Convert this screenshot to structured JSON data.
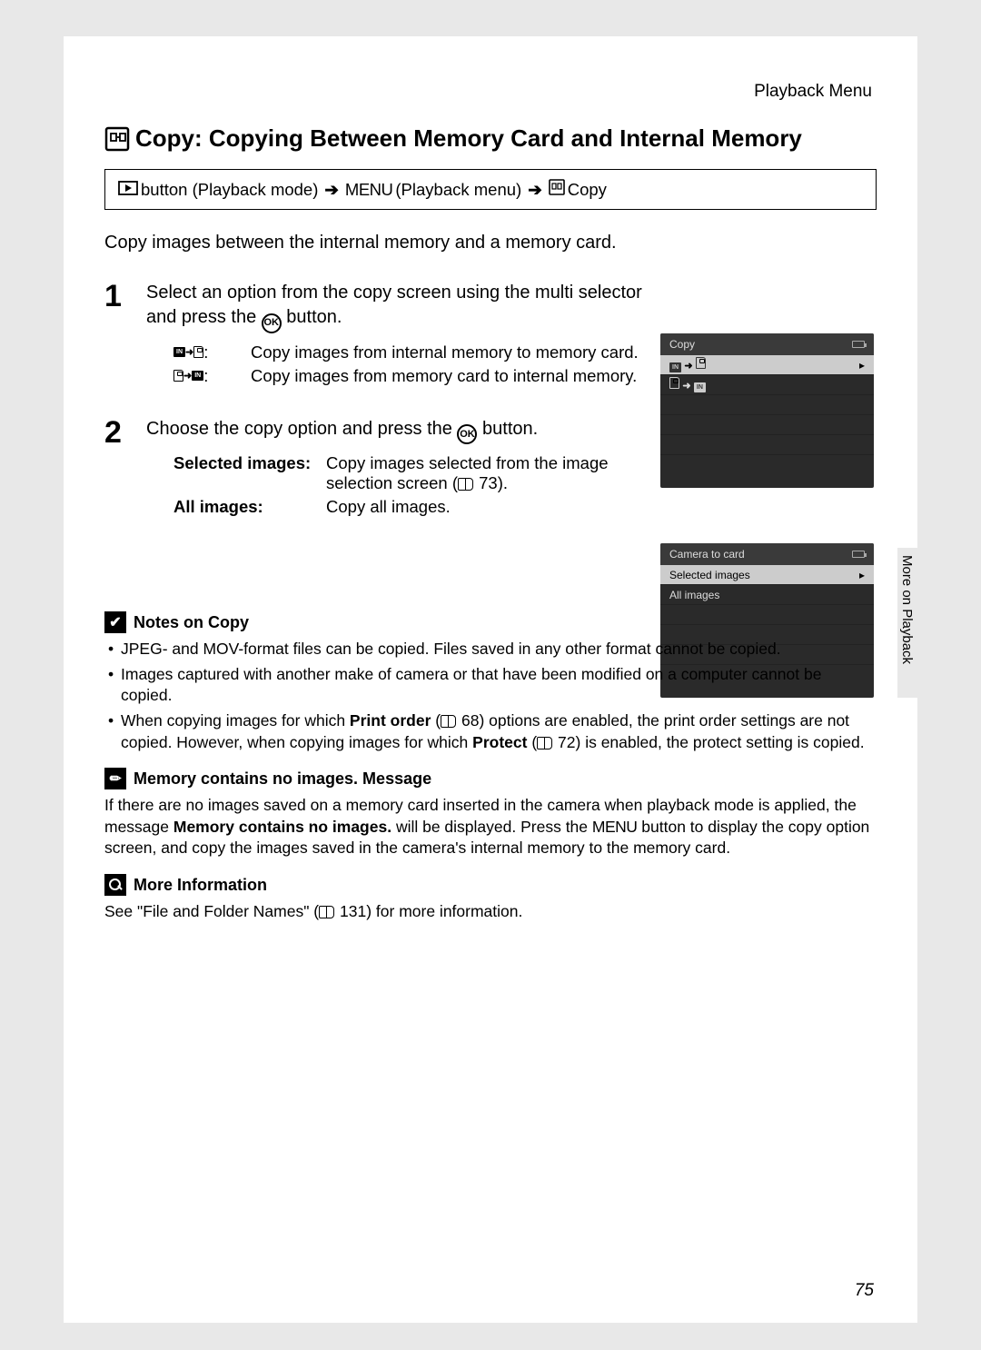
{
  "header": "Playback Menu",
  "sidetab": "More on Playback",
  "title": "Copy: Copying Between Memory Card and Internal Memory",
  "breadcrumb": {
    "b1": "button (Playback mode)",
    "menu": "MENU",
    "b2": "(Playback menu)",
    "b3": "Copy"
  },
  "intro": "Copy images between the internal memory and a memory card.",
  "steps": {
    "s1": {
      "num": "1",
      "heading_a": "Select an option from the copy screen using the multi selector and press the ",
      "heading_b": " button.",
      "opt1": "Copy images from internal memory to memory card.",
      "opt2": "Copy images from memory card to internal memory."
    },
    "s2": {
      "num": "2",
      "heading_a": "Choose the copy option and press the ",
      "heading_b": " button.",
      "sel_lbl": "Selected images",
      "sel_desc_a": "Copy images selected from the image selection screen (",
      "sel_desc_pg": "73",
      "sel_desc_b": ").",
      "all_lbl": "All images",
      "all_desc": "Copy all images."
    }
  },
  "screen1": {
    "title": "Copy"
  },
  "screen2": {
    "title": "Camera to card",
    "r1": "Selected images",
    "r2": "All images"
  },
  "notes": {
    "t1": "Notes on Copy",
    "n1": "JPEG- and MOV-format files can be copied. Files saved in any other format cannot be copied.",
    "n2": "Images captured with another make of camera or that have been modified on a computer cannot be copied.",
    "n3a": "When copying images for which ",
    "n3b": "Print order",
    "n3c": " (",
    "n3pg1": "68",
    "n3d": ") options are enabled, the print order settings are not copied. However, when copying images for which ",
    "n3e": "Protect",
    "n3f": " (",
    "n3pg2": "72",
    "n3g": ") is enabled, the protect setting is copied.",
    "t2": "Memory contains no images. Message",
    "m1a": "If there are no images saved on a memory card inserted in the camera when playback mode is applied, the message ",
    "m1b": "Memory contains no images.",
    "m1c": " will be displayed. Press the ",
    "m1menu": "MENU",
    "m1d": " button to display the copy option screen, and copy the images saved in the camera's internal memory to the memory card.",
    "t3": "More Information",
    "mi_a": "See \"File and Folder Names\" (",
    "mi_pg": "131",
    "mi_b": ") for more information."
  },
  "page_num": "75",
  "ok_label": "OK",
  "in_label": "IN"
}
